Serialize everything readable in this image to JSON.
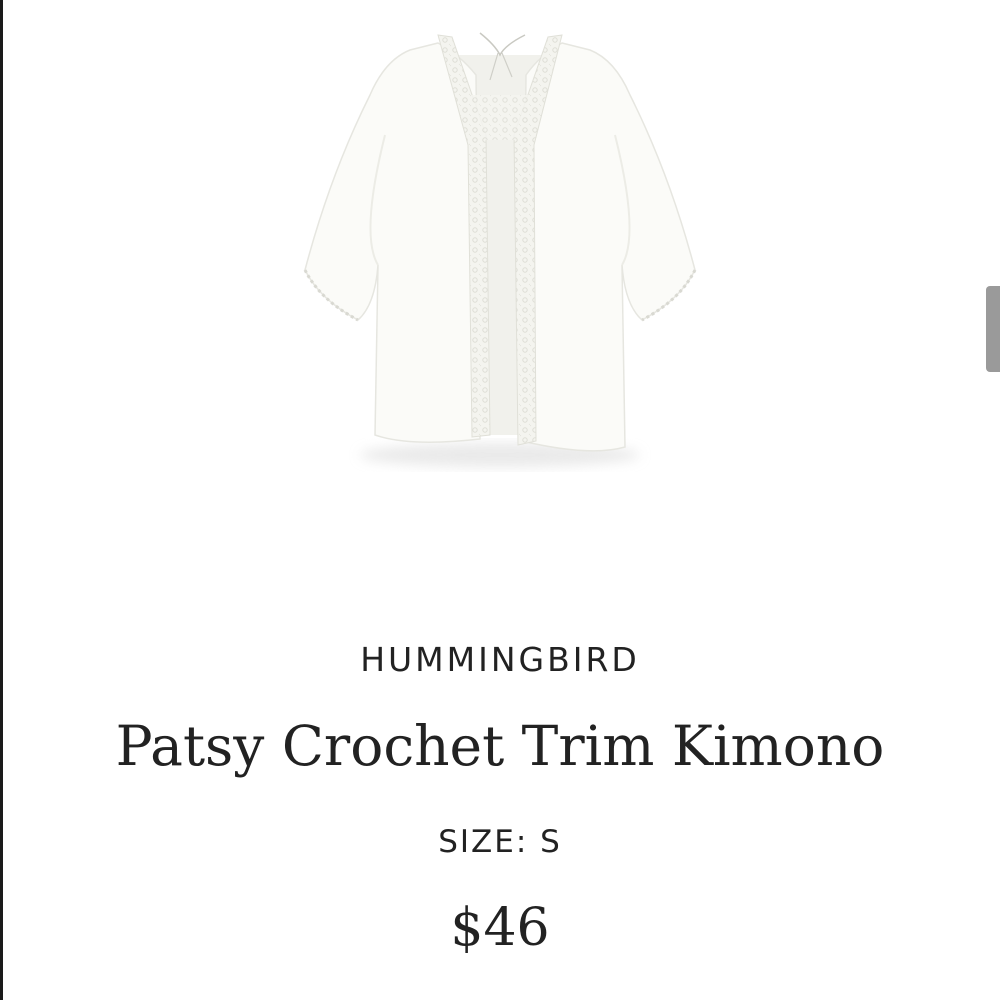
{
  "product": {
    "image_name": "white-crochet-trim-kimono",
    "brand": "HUMMINGBIRD",
    "name": "Patsy Crochet Trim Kimono",
    "size_label": "SIZE: S",
    "price": "$46"
  },
  "colors": {
    "text": "#222222",
    "background": "#ffffff",
    "garment": "#fbfbf8"
  }
}
